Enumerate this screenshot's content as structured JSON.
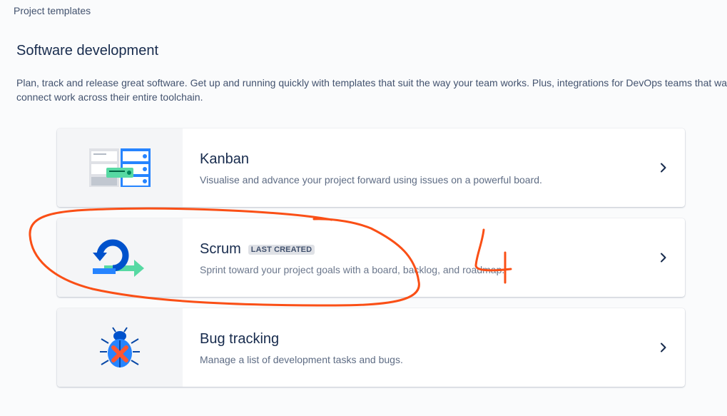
{
  "breadcrumb": "Project templates",
  "section": {
    "title": "Software development",
    "description": "Plan, track and release great software. Get up and running quickly with templates that suit the way your team works. Plus, integrations for DevOps teams that want to connect work across their entire toolchain."
  },
  "templates": [
    {
      "title": "Kanban",
      "description": "Visualise and advance your project forward using issues on a powerful board.",
      "icon": "kanban-board-icon"
    },
    {
      "title": "Scrum",
      "badge": "LAST CREATED",
      "description": "Sprint toward your project goals with a board, backlog, and roadmap.",
      "icon": "scrum-cycle-icon"
    },
    {
      "title": "Bug tracking",
      "description": "Manage a list of development tasks and bugs.",
      "icon": "bug-icon"
    }
  ],
  "annotation": {
    "color": "#fa4f16",
    "digit": "4"
  }
}
